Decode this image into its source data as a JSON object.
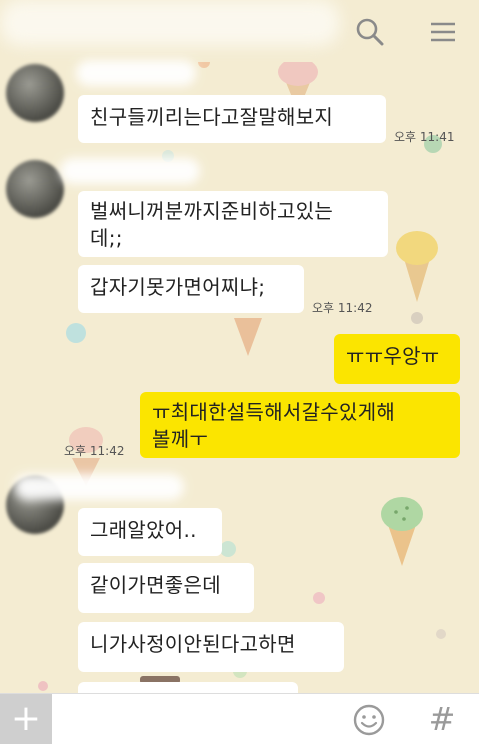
{
  "header": {
    "search_icon": "search-icon",
    "menu_icon": "menu-icon"
  },
  "messages": [
    {
      "text": "친구들끼리는다고잘말해보지",
      "time": "오후 11:41"
    },
    {
      "text": "벌써니꺼분까지준비하고있는\n데;;",
      "time": ""
    },
    {
      "text": "갑자기못가면어찌냐;",
      "time": "오후 11:42"
    },
    {
      "text": "ㅠㅠ우앙ㅠ",
      "time": ""
    },
    {
      "text": "ㅠ최대한설득해서갈수있게해\n볼께ㅜ",
      "time": "오후 11:42"
    },
    {
      "text": "그래알았어..",
      "time": ""
    },
    {
      "text": "같이가면좋은데",
      "time": ""
    },
    {
      "text": "니가사정이안된다고하면",
      "time": ""
    }
  ],
  "input_bar": {
    "plus_icon": "plus-icon",
    "plus_label": "+",
    "emoji_icon": "emoji-icon",
    "hash_icon": "hash-icon",
    "hash_label": "#"
  },
  "colors": {
    "background": "#f4ecd2",
    "incoming_bubble": "#ffffff",
    "outgoing_bubble": "#fbe500"
  }
}
